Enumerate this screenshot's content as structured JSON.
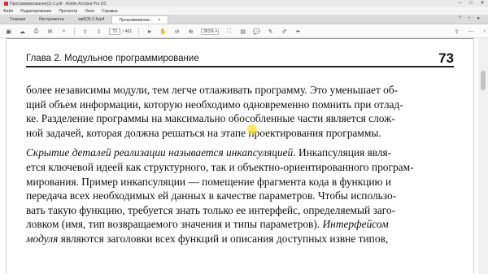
{
  "window": {
    "title": "Программирование(1)-1.pdf - Adobe Acrobat Pro DC"
  },
  "menu": [
    "Файл",
    "Редактирование",
    "Просмотр",
    "Окно",
    "Справка"
  ],
  "tabs": [
    {
      "label": "Главная"
    },
    {
      "label": "Инструменты"
    },
    {
      "label": "мрб(3)-1-Кур4"
    },
    {
      "label": "Программирова..."
    }
  ],
  "toolbar": {
    "page_current": "73",
    "page_total": "/ 461",
    "zoom": "261%"
  },
  "page": {
    "header_chapter": "Глава 2. Модульное программирование",
    "header_number": "73",
    "lines_p1": [
      "более независимы модули, тем легче отлаживать программу. Это уменьшает об-",
      "щий объем информации, которую необходимо одновременно помнить при отлад-",
      "ке. Разделение программы на максимально обособленные части является слож-",
      "ной задачей, которая должна решаться на этапе проектирования программы."
    ],
    "p2_line1_italic": "Скрытие деталей реализации называется инкапсуляцией.",
    "p2_line1_rest": " Инкапсуляция явля-",
    "lines_p2": [
      "ется ключевой идеей как структурного, так и объектно-ориентированного програм-",
      "мирования. Пример инкапсуляции — помещение фрагмента кода в функцию и",
      "передача всех необходимых ей данных в качестве параметров. Чтобы использо-",
      "вать такую функцию, требуется знать только ее интерфейс, определяемый заго-"
    ],
    "p2_line6_regular": "ловком (имя, тип возвращаемого значения и типы параметров). ",
    "p2_line6_italic": "Интерфейсом",
    "p2_line7_italic": "модуля",
    "p2_line7_rest": " являются заголовки всех функций и описания доступных извне типов,"
  }
}
